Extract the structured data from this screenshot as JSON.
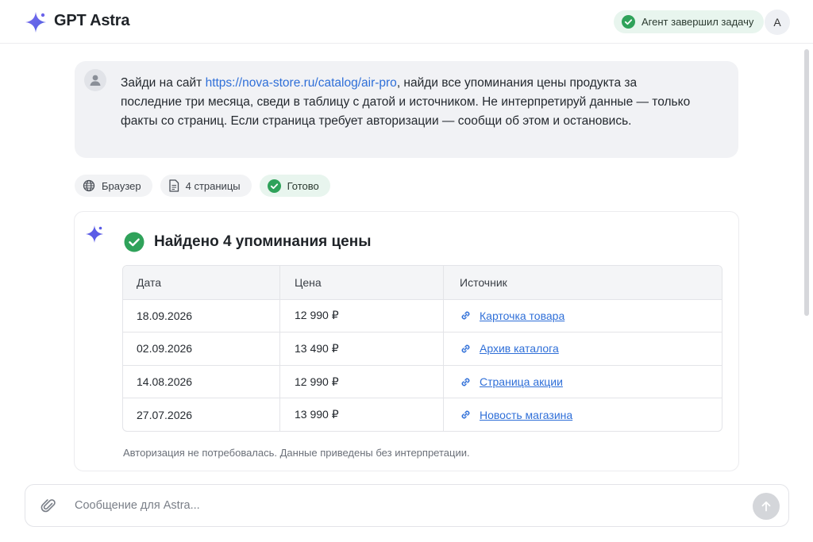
{
  "header": {
    "brand": "GPT Astra",
    "status": "Агент завершил задачу",
    "avatar_initial": "A",
    "icons": {
      "logo": "sparkle-icon",
      "status": "check-circle-icon"
    }
  },
  "user_message": {
    "prefix": "Зайди на сайт ",
    "link": "https://nova-store.ru/catalog/air-pro",
    "suffix": ", найди все упоминания цены продукта за последние три месяца, сведи в таблицу с датой и источником. Не интерпретируй данные — только факты со страниц. Если страница требует авторизации — сообщи об этом и остановись."
  },
  "chips": [
    {
      "label": "Браузер",
      "icon": "globe-icon"
    },
    {
      "label": "4 страницы",
      "icon": "document-icon"
    },
    {
      "label": "Готово",
      "icon": "check-circle-icon"
    }
  ],
  "result": {
    "title": "Найдено 4 упоминания цены",
    "columns": [
      "Дата",
      "Цена",
      "Источник"
    ],
    "rows": [
      {
        "date": "18.09.2026",
        "price": "12 990 ₽",
        "source": "Карточка товара"
      },
      {
        "date": "02.09.2026",
        "price": "13 490 ₽",
        "source": "Архив каталога"
      },
      {
        "date": "14.08.2026",
        "price": "12 990 ₽",
        "source": "Страница акции"
      },
      {
        "date": "27.07.2026",
        "price": "13 990 ₽",
        "source": "Новость магазина"
      }
    ],
    "note": "Авторизация не потребовалась. Данные приведены без интерпретации."
  },
  "composer": {
    "placeholder": "Сообщение для Astra...",
    "icons": {
      "attach": "paperclip-icon",
      "send": "arrow-up-icon"
    }
  },
  "colors": {
    "accent": "#5b5ce6",
    "success": "#2fa25a",
    "link": "#2f6fd8",
    "pill_bg": "#e8f5ee"
  }
}
